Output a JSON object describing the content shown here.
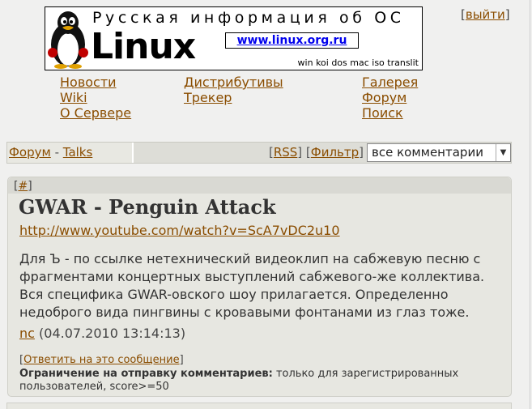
{
  "logo": {
    "tagline": "Русская информация об ОС",
    "word": "Linux",
    "url": "www.linux.org.ru",
    "encodings": "win koi dos mac iso translit"
  },
  "logout": {
    "open": "[",
    "label": "выйти",
    "close": "]"
  },
  "nav": {
    "col1": [
      "Новости",
      "Wiki",
      "О Сервере"
    ],
    "col2": [
      "Дистрибутивы",
      "Трекер"
    ],
    "col3": [
      "Галерея",
      "Форум",
      "Поиск"
    ]
  },
  "forumbar": {
    "crumb_forum": "Форум",
    "crumb_sep": " - ",
    "crumb_section": "Talks",
    "rss_label": "RSS",
    "filter_label": "Фильтр",
    "select_value": "все комментарии"
  },
  "message": {
    "anchor": "#",
    "title": "GWAR - Penguin Attack",
    "link": "http://www.youtube.com/watch?v=ScA7vDC2u10",
    "body": "Для Ъ - по ссылке нетехнический видеоклип на сабжевую песню с фрагментами концертных выступлений сабжевого-же коллектива. Вся специфика GWAR-овского шоу прилагается. Определенно недоброго вида пингвины с кровавыми фонтанами из глаз тоже.",
    "author": "nc",
    "date": "(04.07.2010 13:14:13)",
    "reply_label": "Ответить на это сообщение",
    "limit_label": "Ограничение на отправку комментариев:",
    "limit_text": " только для зарегистрированных пользователей, score>=50"
  }
}
